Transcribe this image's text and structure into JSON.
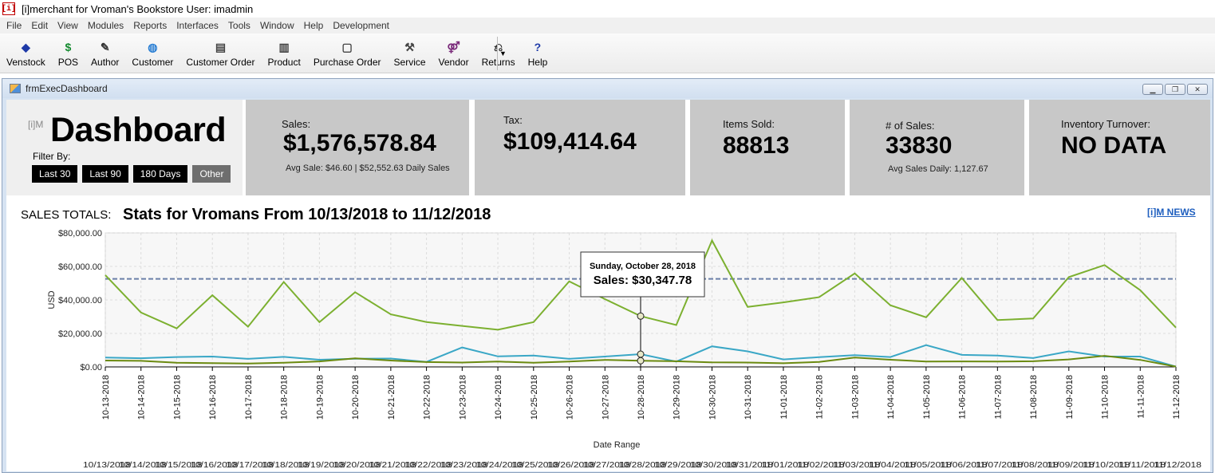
{
  "app": {
    "icon_text": "[i]",
    "title": "[i]merchant for Vroman's Bookstore  User: imadmin"
  },
  "menu": [
    "File",
    "Edit",
    "View",
    "Modules",
    "Reports",
    "Interfaces",
    "Tools",
    "Window",
    "Help",
    "Development"
  ],
  "toolbar": [
    {
      "label": "Venstock",
      "icon": "diamond-icon",
      "glyph": "◆",
      "color": "#1e3aa8"
    },
    {
      "label": "POS",
      "icon": "dollar-icon",
      "glyph": "$",
      "color": "#138a2e"
    },
    {
      "label": "Author",
      "icon": "author-icon",
      "glyph": "✎",
      "color": "#333333"
    },
    {
      "label": "Customer",
      "icon": "globe-icon",
      "glyph": "◍",
      "color": "#2a7fd4"
    },
    {
      "label": "Customer Order",
      "icon": "register-icon",
      "glyph": "▤",
      "color": "#444444"
    },
    {
      "label": "Product",
      "icon": "product-icon",
      "glyph": "▥",
      "color": "#444444"
    },
    {
      "label": "Purchase Order",
      "icon": "document-icon",
      "glyph": "▢",
      "color": "#444444"
    },
    {
      "label": "Service",
      "icon": "wrench-icon",
      "glyph": "⚒",
      "color": "#444444"
    },
    {
      "label": "Vendor",
      "icon": "vendor-icon",
      "glyph": "⚤",
      "color": "#7a2a7a"
    },
    {
      "label": "Returns",
      "icon": "returns-icon",
      "glyph": "⎌",
      "color": "#222222"
    },
    {
      "label": "Help",
      "icon": "help-icon",
      "glyph": "?",
      "color": "#1e3aa8"
    }
  ],
  "child_window": {
    "title": "frmExecDashboard",
    "controls": [
      "minimize",
      "restore",
      "close"
    ]
  },
  "dashboard": {
    "logo_text": "[i]M",
    "title": "Dashboard",
    "filter_label": "Filter By:",
    "filters": [
      "Last 30",
      "Last 90",
      "180 Days",
      "Other"
    ]
  },
  "kpis": {
    "sales": {
      "label": "Sales:",
      "value": "$1,576,578.84",
      "sub": "Avg Sale: $46.60 | $52,552.63 Daily Sales"
    },
    "tax": {
      "label": "Tax:",
      "value": "$109,414.64"
    },
    "items_sold": {
      "label": "Items Sold:",
      "value": "88813"
    },
    "num_sales": {
      "label": "# of Sales:",
      "value": "33830",
      "sub": "Avg Sales Daily: 1,127.67"
    },
    "inventory": {
      "label": "Inventory Turnover:",
      "value": "NO DATA"
    }
  },
  "section": {
    "sales_totals_label": "SALES TOTALS:",
    "stats_title": "Stats for Vromans From 10/13/2018 to 11/12/2018",
    "news_link": "[i]M NEWS"
  },
  "tooltip": {
    "date": "Sunday, October 28, 2018",
    "text": "Sales: $30,347.78"
  },
  "colors": {
    "sales": "#7cb030",
    "teal": "#3aa7c6",
    "olive": "#6b8a10",
    "average": "#6b7fa8",
    "kpi_bg": "#c8c8c8"
  },
  "chart_data": {
    "type": "line",
    "ylabel": "USD",
    "xlabel": "Date Range",
    "ylim": [
      0,
      80000
    ],
    "yticks": [
      "$0.00",
      "$20,000.00",
      "$40,000.00",
      "$60,000.00",
      "$80,000.00"
    ],
    "ytick_values": [
      0,
      20000,
      40000,
      60000,
      80000
    ],
    "categories": [
      "10-13-2018",
      "10-14-2018",
      "10-15-2018",
      "10-16-2018",
      "10-17-2018",
      "10-18-2018",
      "10-19-2018",
      "10-20-2018",
      "10-21-2018",
      "10-22-2018",
      "10-23-2018",
      "10-24-2018",
      "10-25-2018",
      "10-26-2018",
      "10-27-2018",
      "10-28-2018",
      "10-29-2018",
      "10-30-2018",
      "10-31-2018",
      "11-01-2018",
      "11-02-2018",
      "11-03-2018",
      "11-04-2018",
      "11-05-2018",
      "11-06-2018",
      "11-07-2018",
      "11-08-2018",
      "11-09-2018",
      "11-10-2018",
      "11-11-2018",
      "11-12-2018"
    ],
    "series": [
      {
        "values": [
          54800,
          32500,
          23000,
          42800,
          24000,
          50700,
          26700,
          44600,
          31400,
          26800,
          24500,
          22200,
          26700,
          51100,
          40500,
          30348,
          25000,
          75500,
          35800,
          38500,
          41600,
          55800,
          36800,
          29600,
          53100,
          28000,
          28900,
          53600,
          60800,
          45800,
          23500
        ]
      },
      {
        "values": [
          5600,
          5200,
          5900,
          6200,
          4800,
          6000,
          4300,
          4900,
          5000,
          3000,
          11600,
          6300,
          6800,
          4800,
          6200,
          7600,
          3200,
          12300,
          9300,
          4500,
          5800,
          7000,
          5900,
          13000,
          7200,
          6800,
          5300,
          9300,
          6200,
          6200,
          200
        ]
      },
      {
        "values": [
          3800,
          3600,
          2500,
          2300,
          2000,
          2500,
          3300,
          5100,
          3800,
          2900,
          2600,
          3200,
          2500,
          3200,
          4200,
          3700,
          3400,
          2700,
          2600,
          2200,
          3000,
          5600,
          4300,
          3200,
          3300,
          3200,
          3400,
          4500,
          6600,
          4200,
          200
        ]
      }
    ],
    "average": 52552.63,
    "highlight_index": 15,
    "overflow_axis_text": "10/13/2018 00:00 ... 11/12/2018 00:00 (overlapping labels)"
  }
}
